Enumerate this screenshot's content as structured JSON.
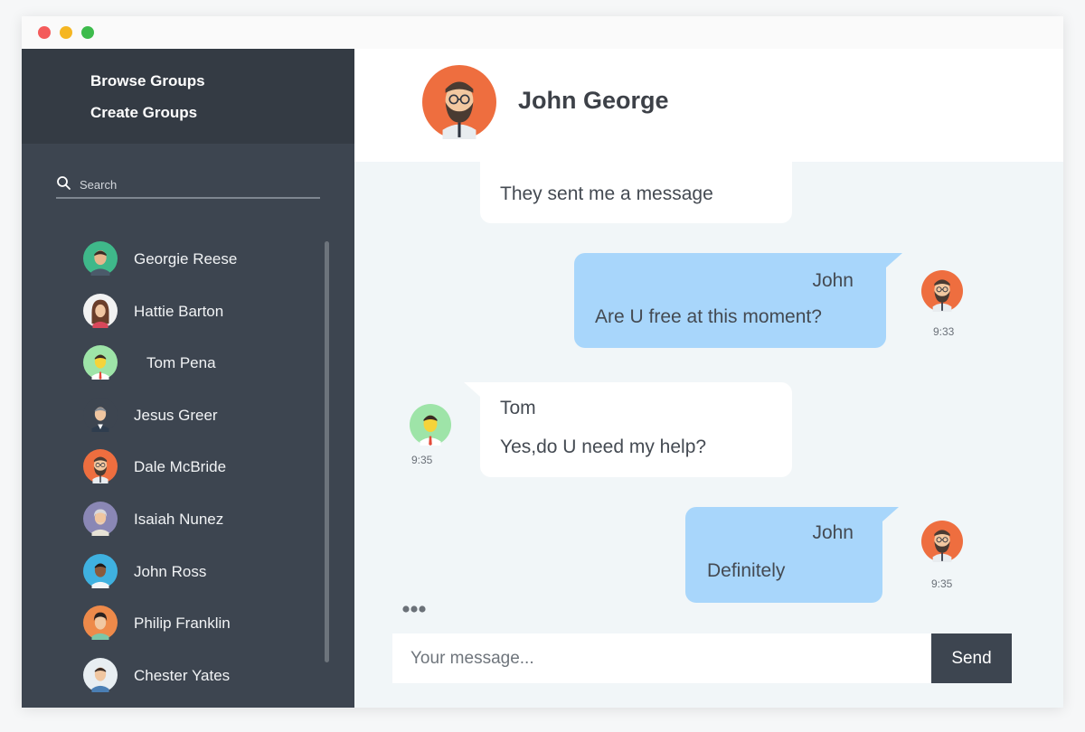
{
  "sidebar": {
    "nav": {
      "browse_groups": "Browse Groups",
      "create_groups": "Create Groups"
    },
    "search": {
      "placeholder": "Search",
      "icon": "search-icon"
    },
    "contacts": [
      {
        "name": "Georgie Reese",
        "avatar": "man-green-shirt"
      },
      {
        "name": "Hattie Barton",
        "avatar": "woman-brown-hair"
      },
      {
        "name": "Tom Pena",
        "avatar": "man-red-tie"
      },
      {
        "name": "Jesus Greer",
        "avatar": "man-suit-grey-hair"
      },
      {
        "name": "Dale McBride",
        "avatar": "man-beard-glasses"
      },
      {
        "name": "Isaiah Nunez",
        "avatar": "old-man-grey"
      },
      {
        "name": "John Ross",
        "avatar": "man-dark-skin"
      },
      {
        "name": "Philip Franklin",
        "avatar": "man-orange-background"
      },
      {
        "name": "Chester Yates",
        "avatar": "man-light-background"
      }
    ]
  },
  "chat": {
    "header": {
      "name": "John George",
      "avatar": "man-beard-glasses"
    },
    "messages": [
      {
        "direction": "in",
        "text": "They sent me a message"
      },
      {
        "direction": "out",
        "sender": "John",
        "text": "Are U free at this moment?",
        "time": "9:33"
      },
      {
        "direction": "in",
        "sender": "Tom",
        "text": "Yes,do U need  my help?",
        "time": "9:35"
      },
      {
        "direction": "out",
        "sender": "John",
        "text": "Definitely",
        "time": "9:35"
      }
    ],
    "typing_icon": "typing-dots-icon"
  },
  "composer": {
    "placeholder": "Your message...",
    "send_label": "Send"
  },
  "colors": {
    "sidebar": "#3d4550",
    "sidebar_top": "#343b44",
    "outgoing_bubble": "#a8d6fb",
    "incoming_bubble": "#ffffff",
    "chat_background": "#f1f6f8",
    "beard_avatar_bg": "#ee6e3f"
  }
}
